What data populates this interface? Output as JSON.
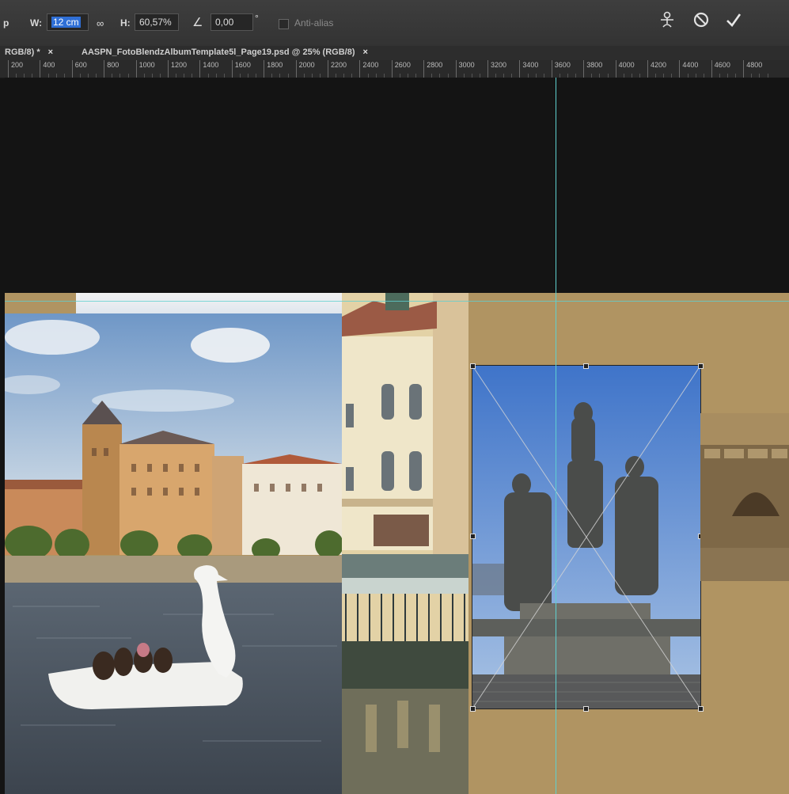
{
  "options_bar": {
    "tool_letter": "p",
    "w_label": "W:",
    "w_value": "12 cm",
    "link_icon": "link-icon",
    "h_label": "H:",
    "h_value": "60,57%",
    "angle_icon": "angle-icon",
    "angle_value": "0,00",
    "angle_unit": "°",
    "antialias_label": "Anti-alias",
    "warp_icon": "warp-icon",
    "cancel_icon": "cancel-icon",
    "commit_icon": "commit-icon"
  },
  "tabs": [
    {
      "label": "RGB/8) *",
      "close": "×"
    },
    {
      "label": "AASPN_FotoBlendzAlbumTemplate5l_Page19.psd @ 25% (RGB/8)",
      "close": "×"
    }
  ],
  "ruler": {
    "labels": [
      "200",
      "400",
      "600",
      "800",
      "1000",
      "1200",
      "1400",
      "1600",
      "1800",
      "2000",
      "2200",
      "2400",
      "2600",
      "2800",
      "3000",
      "3200",
      "3400",
      "3600",
      "3800",
      "4000",
      "4200",
      "4400",
      "4600",
      "4800"
    ]
  },
  "colors": {
    "guide": "#5fd0cf",
    "paper": "#b09462",
    "selection_highlight": "#2f6fd6"
  }
}
